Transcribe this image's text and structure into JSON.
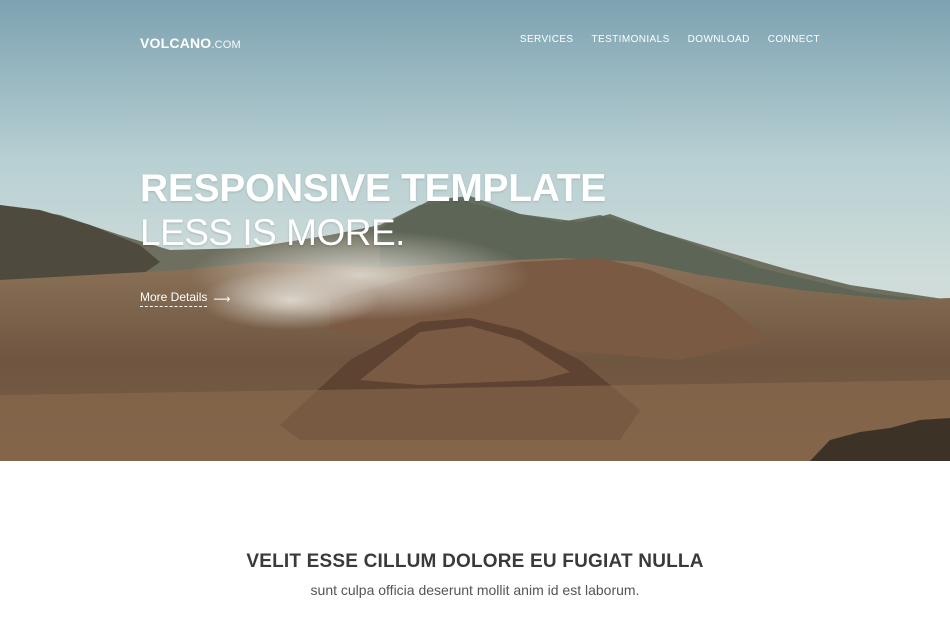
{
  "brand": {
    "name": "VOLCANO",
    "suffix": ".COM"
  },
  "nav": {
    "items": [
      "SERVICES",
      "TESTIMONIALS",
      "DOWNLOAD",
      "CONNECT"
    ]
  },
  "hero": {
    "title": "RESPONSIVE TEMPLATE",
    "subtitle": "LESS IS MORE.",
    "cta_label": "More Details",
    "cta_arrow": "⟶"
  },
  "section": {
    "title": "VELIT ESSE CILLUM DOLORE EU FUGIAT NULLA",
    "subtitle": "sunt culpa officia deserunt mollit anim id est laborum."
  },
  "colors": {
    "text_dark": "#3a3a3a",
    "text_muted": "#555555",
    "hero_text": "#ffffff"
  }
}
